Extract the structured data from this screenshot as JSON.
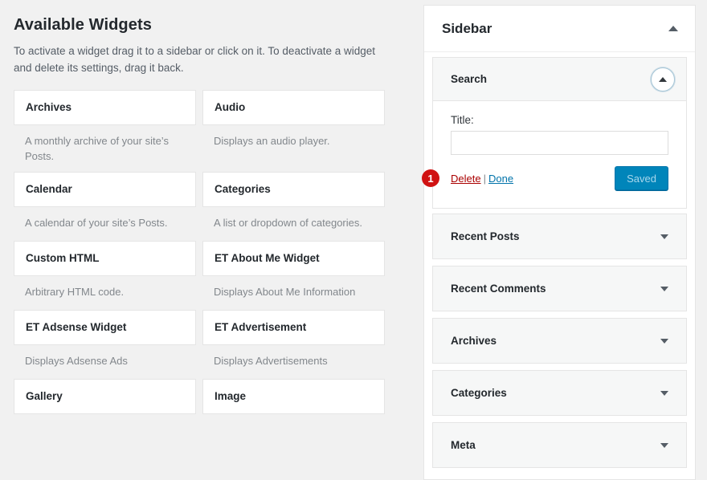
{
  "available": {
    "title": "Available Widgets",
    "description": "To activate a widget drag it to a sidebar or click on it. To deactivate a widget and delete its settings, drag it back.",
    "widgets": [
      {
        "name": "Archives",
        "desc": "A monthly archive of your site’s Posts."
      },
      {
        "name": "Audio",
        "desc": "Displays an audio player."
      },
      {
        "name": "Calendar",
        "desc": "A calendar of your site’s Posts."
      },
      {
        "name": "Categories",
        "desc": "A list or dropdown of categories."
      },
      {
        "name": "Custom HTML",
        "desc": "Arbitrary HTML code."
      },
      {
        "name": "ET About Me Widget",
        "desc": "Displays About Me Information"
      },
      {
        "name": "ET Adsense Widget",
        "desc": "Displays Adsense Ads"
      },
      {
        "name": "ET Advertisement",
        "desc": "Displays Advertisements"
      },
      {
        "name": "Gallery",
        "desc": ""
      },
      {
        "name": "Image",
        "desc": ""
      }
    ]
  },
  "sidebar": {
    "heading": "Sidebar",
    "collapse_icon": "chevron-up-icon",
    "open_widget": {
      "title": "Search",
      "toggle_icon": "chevron-up-icon",
      "title_label": "Title:",
      "title_value": "",
      "title_placeholder": "",
      "delete_label": "Delete",
      "separator": "|",
      "done_label": "Done",
      "save_label": "Saved",
      "annotation_badge": "1"
    },
    "collapsed_widgets": [
      {
        "title": "Recent Posts",
        "toggle_icon": "chevron-down-icon"
      },
      {
        "title": "Recent Comments",
        "toggle_icon": "chevron-down-icon"
      },
      {
        "title": "Archives",
        "toggle_icon": "chevron-down-icon"
      },
      {
        "title": "Categories",
        "toggle_icon": "chevron-down-icon"
      },
      {
        "title": "Meta",
        "toggle_icon": "chevron-down-icon"
      }
    ]
  },
  "colors": {
    "page_bg": "#f1f1f1",
    "card_bg": "#ffffff",
    "border": "#e5e5e5",
    "text": "#23282d",
    "muted_text": "#82878c",
    "link_blue": "#0073aa",
    "delete_red": "#a00000",
    "button_blue": "#0085ba",
    "badge_red": "#d01212"
  }
}
